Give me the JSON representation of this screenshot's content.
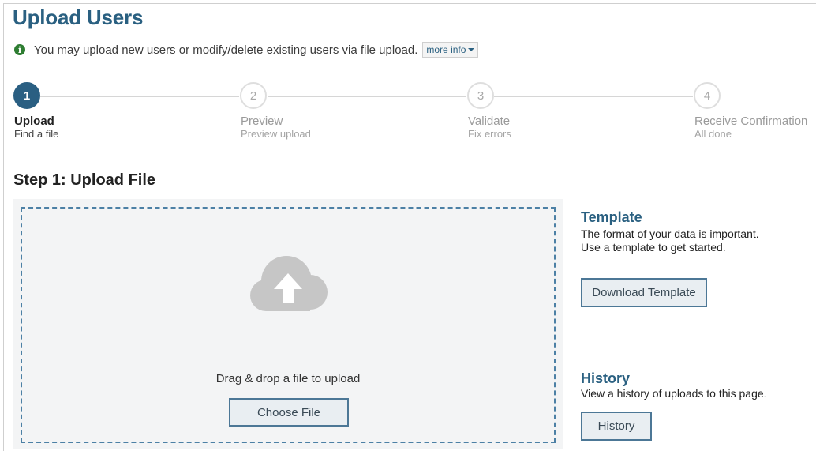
{
  "header": {
    "title": "Upload Users",
    "info_text": "You may upload new users or modify/delete existing users via file upload.",
    "more_info_label": "more info"
  },
  "stepper": {
    "steps": [
      {
        "number": "1",
        "title": "Upload",
        "subtitle": "Find a file",
        "active": true
      },
      {
        "number": "2",
        "title": "Preview",
        "subtitle": "Preview upload",
        "active": false
      },
      {
        "number": "3",
        "title": "Validate",
        "subtitle": "Fix errors",
        "active": false
      },
      {
        "number": "4",
        "title": "Receive Confirmation",
        "subtitle": "All done",
        "active": false
      }
    ]
  },
  "main": {
    "section_title": "Step 1: Upload File",
    "drop_text": "Drag & drop a file to upload",
    "choose_file_label": "Choose File"
  },
  "sidebar": {
    "template_heading": "Template",
    "template_text": "The format of your data is important. Use a template to get started.",
    "download_template_label": "Download Template",
    "history_heading": "History",
    "history_text": "View a history of uploads to this page.",
    "history_button_label": "History"
  },
  "colors": {
    "brand": "#2a6081",
    "active_step": "#2a5f82",
    "info_icon": "#2e7d32",
    "dropzone_border": "#4c80a5",
    "cloud_icon": "#c6c6c6"
  },
  "icons": {
    "info": "info-circle-icon",
    "more_info_caret": "caret-down-icon",
    "upload": "cloud-upload-icon"
  }
}
